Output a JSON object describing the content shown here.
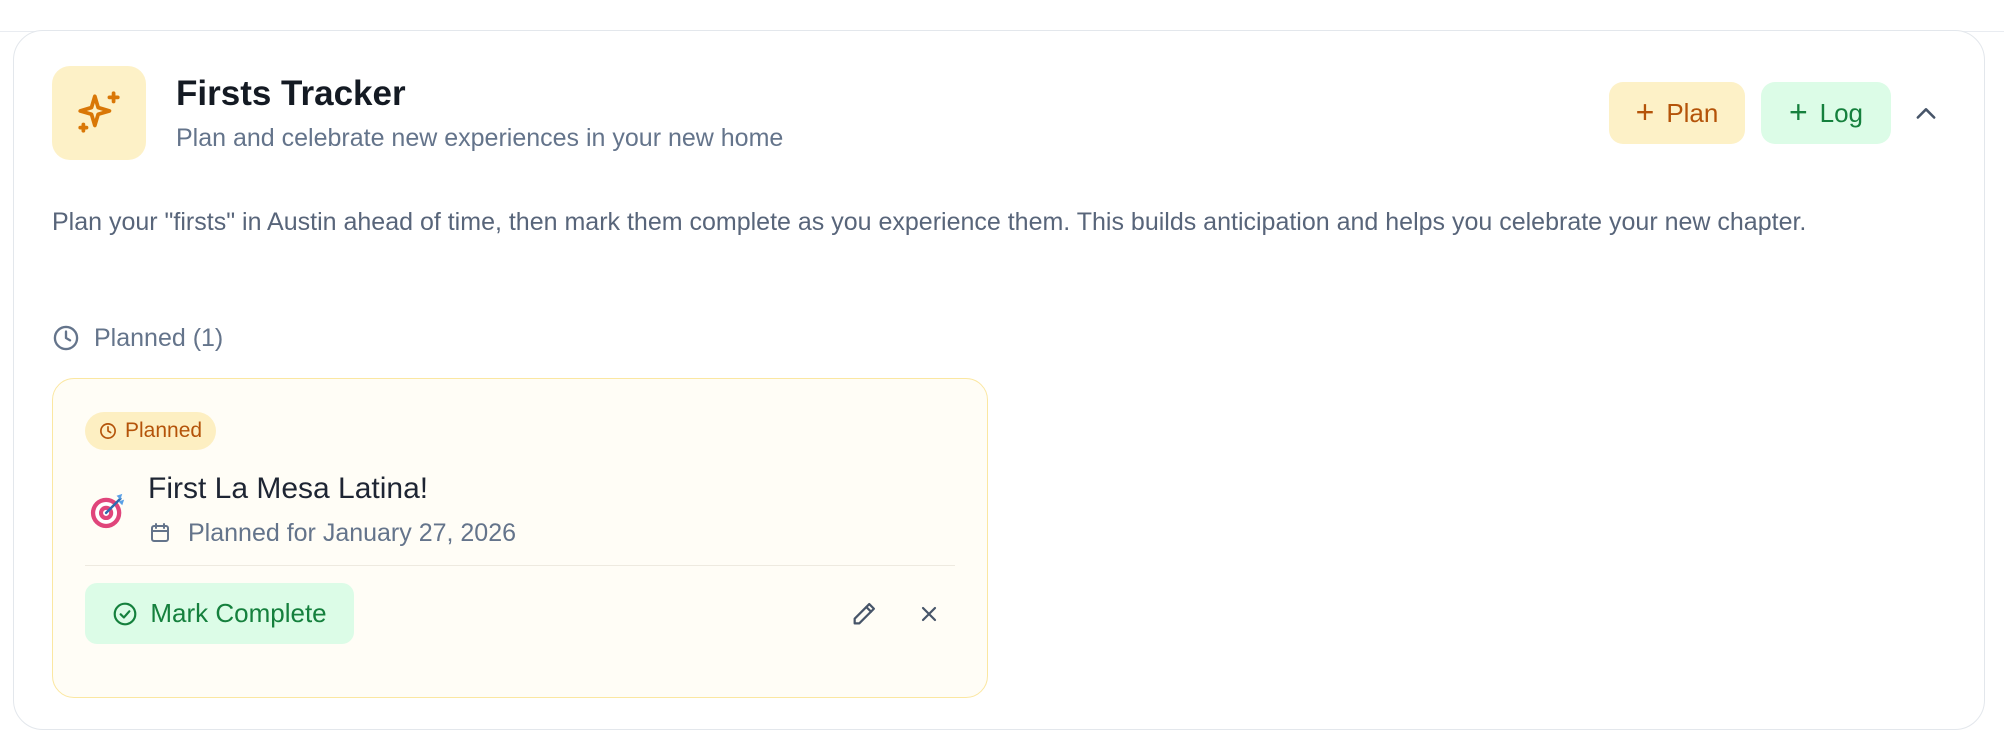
{
  "header": {
    "icon": "sparkles-icon",
    "title": "Firsts Tracker",
    "subtitle": "Plan and celebrate new experiences in your new home",
    "plan_button": "Plan",
    "log_button": "Log"
  },
  "description": "Plan your \"firsts\" in Austin ahead of time, then mark them complete as you experience them. This builds anticipation and helps you celebrate your new chapter.",
  "planned_section": {
    "label": "Planned (1)",
    "items": [
      {
        "status": "Planned",
        "icon": "bullseye-emoji",
        "title": "First La Mesa Latina!",
        "date": "Planned for January 27, 2026",
        "complete_button": "Mark Complete"
      }
    ]
  },
  "colors": {
    "amber_bg": "#fdf1c7",
    "amber_text": "#b45309",
    "green_bg": "#dcfce7",
    "green_text": "#15803d"
  }
}
